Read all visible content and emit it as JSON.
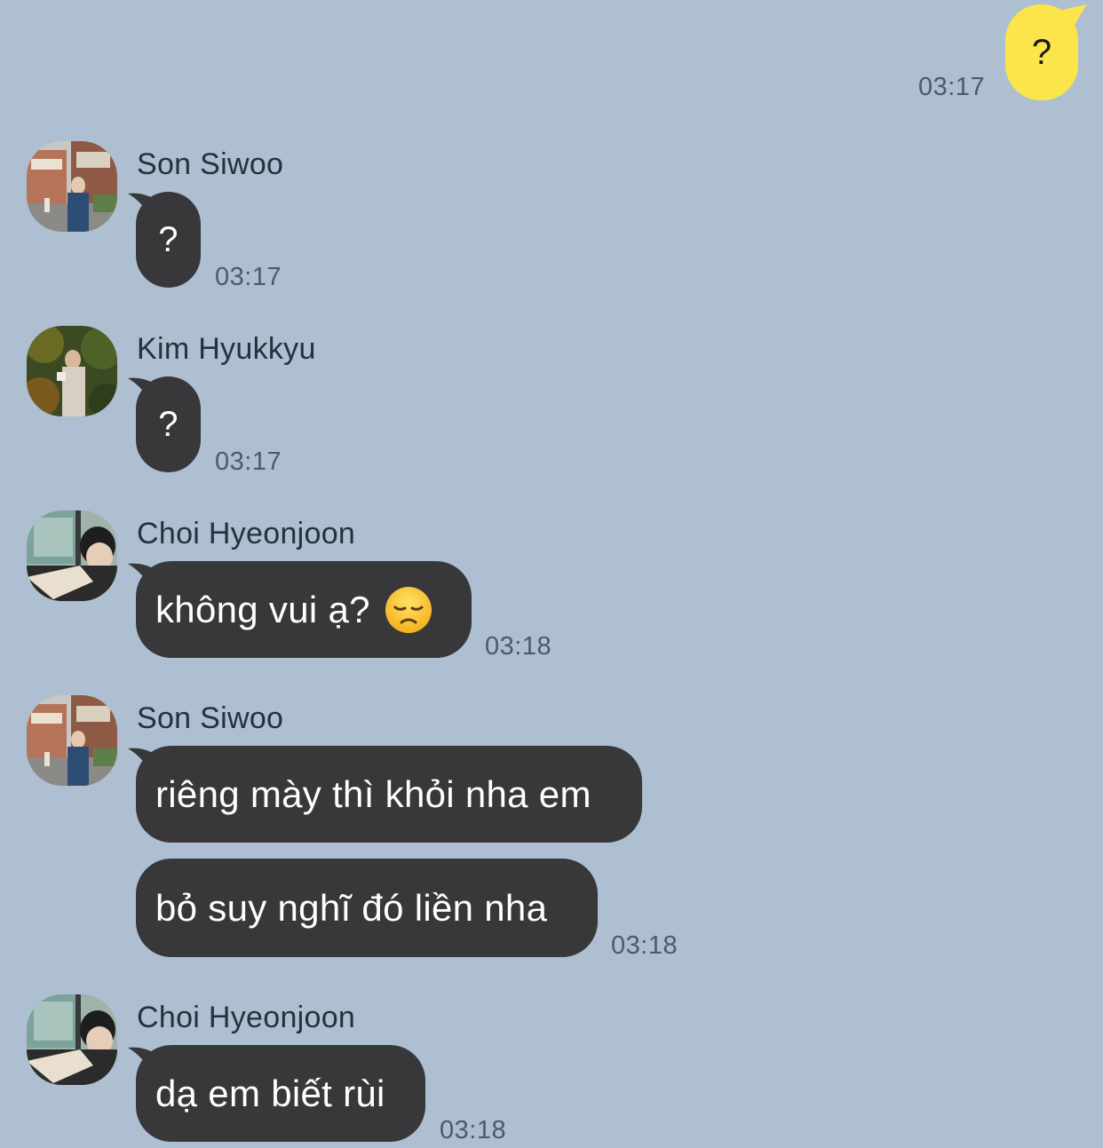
{
  "outgoing": {
    "text": "?",
    "time": "03:17",
    "bubble_color": "#fbe54b"
  },
  "messages": [
    {
      "sender": "Son Siwoo",
      "texts": [
        "?"
      ],
      "time": "03:17"
    },
    {
      "sender": "Kim Hyukkyu",
      "texts": [
        "?"
      ],
      "time": "03:17"
    },
    {
      "sender": "Choi Hyeonjoon",
      "texts": [
        "không vui ạ?"
      ],
      "emoji": "disappointed-face-icon",
      "time": "03:18"
    },
    {
      "sender": "Son Siwoo",
      "texts": [
        "riêng mày thì khỏi nha em",
        "bỏ suy nghĩ đó liền nha"
      ],
      "time": "03:18"
    },
    {
      "sender": "Choi Hyeonjoon",
      "texts": [
        "dạ em biết rùi"
      ],
      "time": "03:18"
    }
  ],
  "colors": {
    "background": "#adbfd0",
    "incoming_bubble": "#38383b",
    "incoming_text": "#ffffff"
  }
}
